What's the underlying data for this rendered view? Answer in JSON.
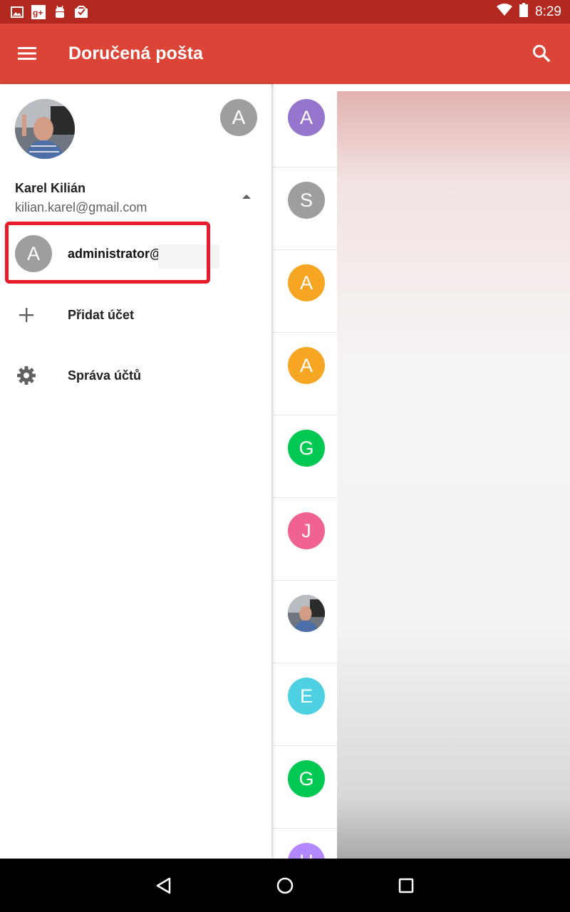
{
  "status_bar": {
    "notification_icons": [
      "image-icon",
      "google-plus-icon",
      "android-icon",
      "inbox-check-icon"
    ],
    "time": "8:29"
  },
  "app_bar": {
    "title": "Doručená pošta",
    "color": "#db4437"
  },
  "drawer": {
    "account_name": "Karel Kilián",
    "account_email": "kilian.karel@gmail.com",
    "other_account_initial": "A",
    "accounts": [
      {
        "initial": "A",
        "label": "administrator@"
      }
    ],
    "menu": [
      {
        "icon": "plus-icon",
        "label": "Přidat účet"
      },
      {
        "icon": "gear-icon",
        "label": "Správa účtů"
      }
    ]
  },
  "message_list": {
    "avatars": [
      {
        "initial": "A",
        "color": "#9575cd"
      },
      {
        "initial": "S",
        "color": "#9e9e9e"
      },
      {
        "initial": "A",
        "color": "#f6a623"
      },
      {
        "initial": "A",
        "color": "#f6a623"
      },
      {
        "initial": "G",
        "color": "#00c853"
      },
      {
        "initial": "J",
        "color": "#f06292"
      },
      {
        "initial": "",
        "color": "#8a8f96",
        "photo": true
      },
      {
        "initial": "E",
        "color": "#4dd0e1"
      },
      {
        "initial": "G",
        "color": "#00c853"
      },
      {
        "initial": "H",
        "color": "#b388ff"
      }
    ]
  }
}
